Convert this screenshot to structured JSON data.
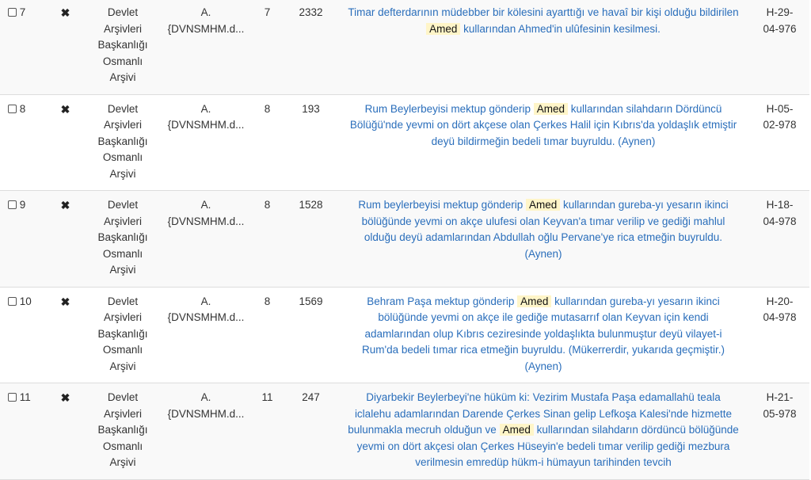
{
  "rows": [
    {
      "index": "7",
      "archive": [
        "Devlet",
        "Arşivleri",
        "Başkanlığı",
        "Osmanlı",
        "Arşivi"
      ],
      "fond": [
        "A.",
        "{DVNSMHM.d..."
      ],
      "vol": "7",
      "no": "2332",
      "summary": {
        "before": "Timar defterdarının müdebber bir kölesini ayarttığı ve havaî bir kişi olduğu bildirilen ",
        "highlight": "Amed",
        "after": " kullarından Ahmed'in ulûfesinin kesilmesi."
      },
      "date": [
        "H-29-",
        "04-976"
      ]
    },
    {
      "index": "8",
      "archive": [
        "Devlet",
        "Arşivleri",
        "Başkanlığı",
        "Osmanlı",
        "Arşivi"
      ],
      "fond": [
        "A.",
        "{DVNSMHM.d..."
      ],
      "vol": "8",
      "no": "193",
      "summary": {
        "before": "Rum Beylerbeyisi mektup gönderip ",
        "highlight": "Amed",
        "after": " kullarından silahdarın Dördüncü Bölüğü'nde yevmi on dört akçese olan Çerkes Halil için Kıbrıs'da yoldaşlık etmiştir deyü bildirmeğin bedeli tımar buyruldu. (Aynen)"
      },
      "date": [
        "H-05-",
        "02-978"
      ]
    },
    {
      "index": "9",
      "archive": [
        "Devlet",
        "Arşivleri",
        "Başkanlığı",
        "Osmanlı",
        "Arşivi"
      ],
      "fond": [
        "A.",
        "{DVNSMHM.d..."
      ],
      "vol": "8",
      "no": "1528",
      "summary": {
        "before": "Rum beylerbeyisi mektup gönderip ",
        "highlight": "Amed",
        "after": " kullarından gureba-yı yesarın ikinci bölüğünde yevmi on akçe ulufesi olan Keyvan'a tımar verilip ve gediği mahlul olduğu deyü adamlarından Abdullah oğlu Pervane'ye rica etmeğin buyruldu. (Aynen)"
      },
      "date": [
        "H-18-",
        "04-978"
      ]
    },
    {
      "index": "10",
      "archive": [
        "Devlet",
        "Arşivleri",
        "Başkanlığı",
        "Osmanlı",
        "Arşivi"
      ],
      "fond": [
        "A.",
        "{DVNSMHM.d..."
      ],
      "vol": "8",
      "no": "1569",
      "summary": {
        "before": "Behram Paşa mektup gönderip ",
        "highlight": "Amed",
        "after": " kullarından gureba-yı yesarın ikinci bölüğünde yevmi on akçe ile gediğe mutasarrıf olan Keyvan için kendi adamlarından olup Kıbrıs ceziresinde yoldaşlıkta bulunmuştur deyü vilayet-i Rum'da bedeli tımar rica etmeğin buyruldu. (Mükerrerdir, yukarıda geçmiştir.) (Aynen)"
      },
      "date": [
        "H-20-",
        "04-978"
      ]
    },
    {
      "index": "11",
      "archive": [
        "Devlet",
        "Arşivleri",
        "Başkanlığı",
        "Osmanlı",
        "Arşivi"
      ],
      "fond": [
        "A.",
        "{DVNSMHM.d..."
      ],
      "vol": "11",
      "no": "247",
      "summary": {
        "before": "Diyarbekir Beylerbeyi'ne hüküm ki: Vezirim Mustafa Paşa edamallahü teala iclalehu adamlarından Darende Çerkes Sinan gelip Lefkoşa Kalesi'nde hizmette bulunmakla mecruh olduğun ve ",
        "highlight": "Amed",
        "after": " kullarından silahdarın dördüncü bölüğünde yevmi on dört akçesi olan Çerkes Hüseyin'e bedeli tımar verilip gediği mezbura verilmesin emredüp hükm-i hümayun tarihinden tevcih"
      },
      "date": [
        "H-21-",
        "05-978"
      ]
    }
  ]
}
